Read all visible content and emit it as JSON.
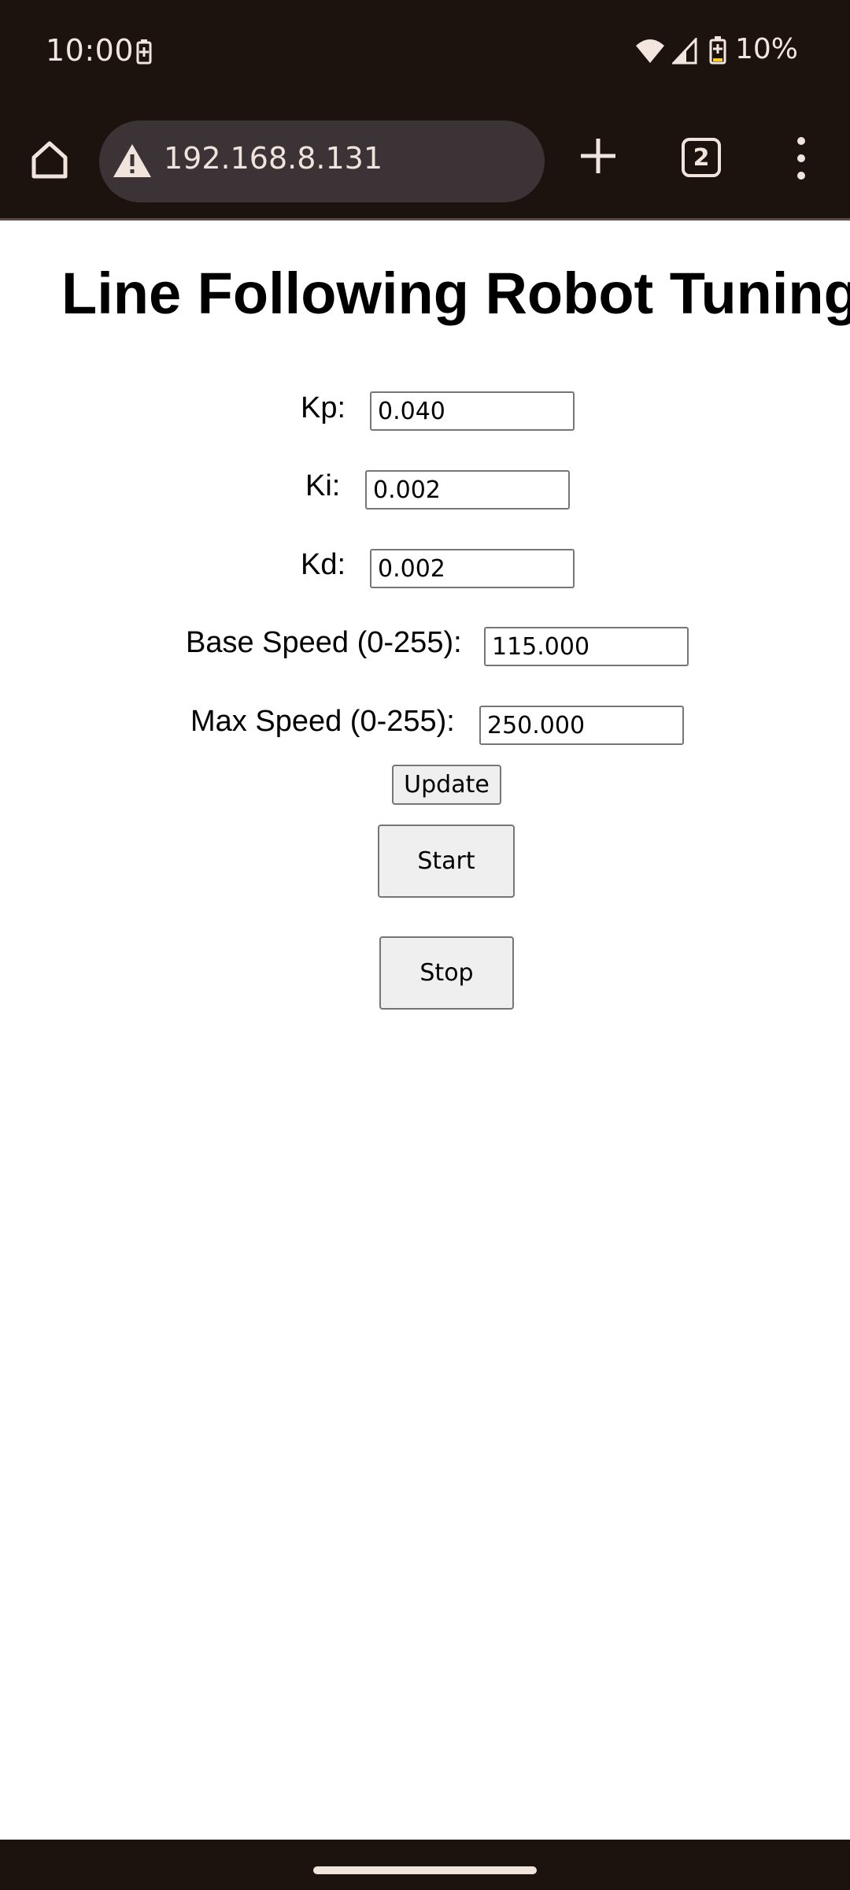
{
  "status_bar": {
    "time": "10:00",
    "battery_percent": "10%",
    "battery_icon": "battery-charging-icon",
    "wifi_icon": "wifi-icon",
    "signal_icon": "cell-signal-icon"
  },
  "browser": {
    "url": "192.168.8.131",
    "tab_count": "2",
    "icons": [
      "home-icon",
      "warning-icon",
      "plus-icon",
      "more-vert-icon"
    ]
  },
  "page": {
    "title": "Line Following Robot Tuning",
    "fields": {
      "kp": {
        "label": "Kp:",
        "value": "0.040"
      },
      "ki": {
        "label": "Ki:",
        "value": "0.002"
      },
      "kd": {
        "label": "Kd:",
        "value": "0.002"
      },
      "base_speed": {
        "label": "Base Speed (0-255):",
        "value": "115.000"
      },
      "max_speed": {
        "label": "Max Speed (0-255):",
        "value": "250.000"
      }
    },
    "buttons": {
      "update": "Update",
      "start": "Start",
      "stop": "Stop"
    }
  },
  "colors": {
    "system_bar": "#1c120e",
    "url_box": "#3b3336",
    "button_bg": "#efefef"
  }
}
